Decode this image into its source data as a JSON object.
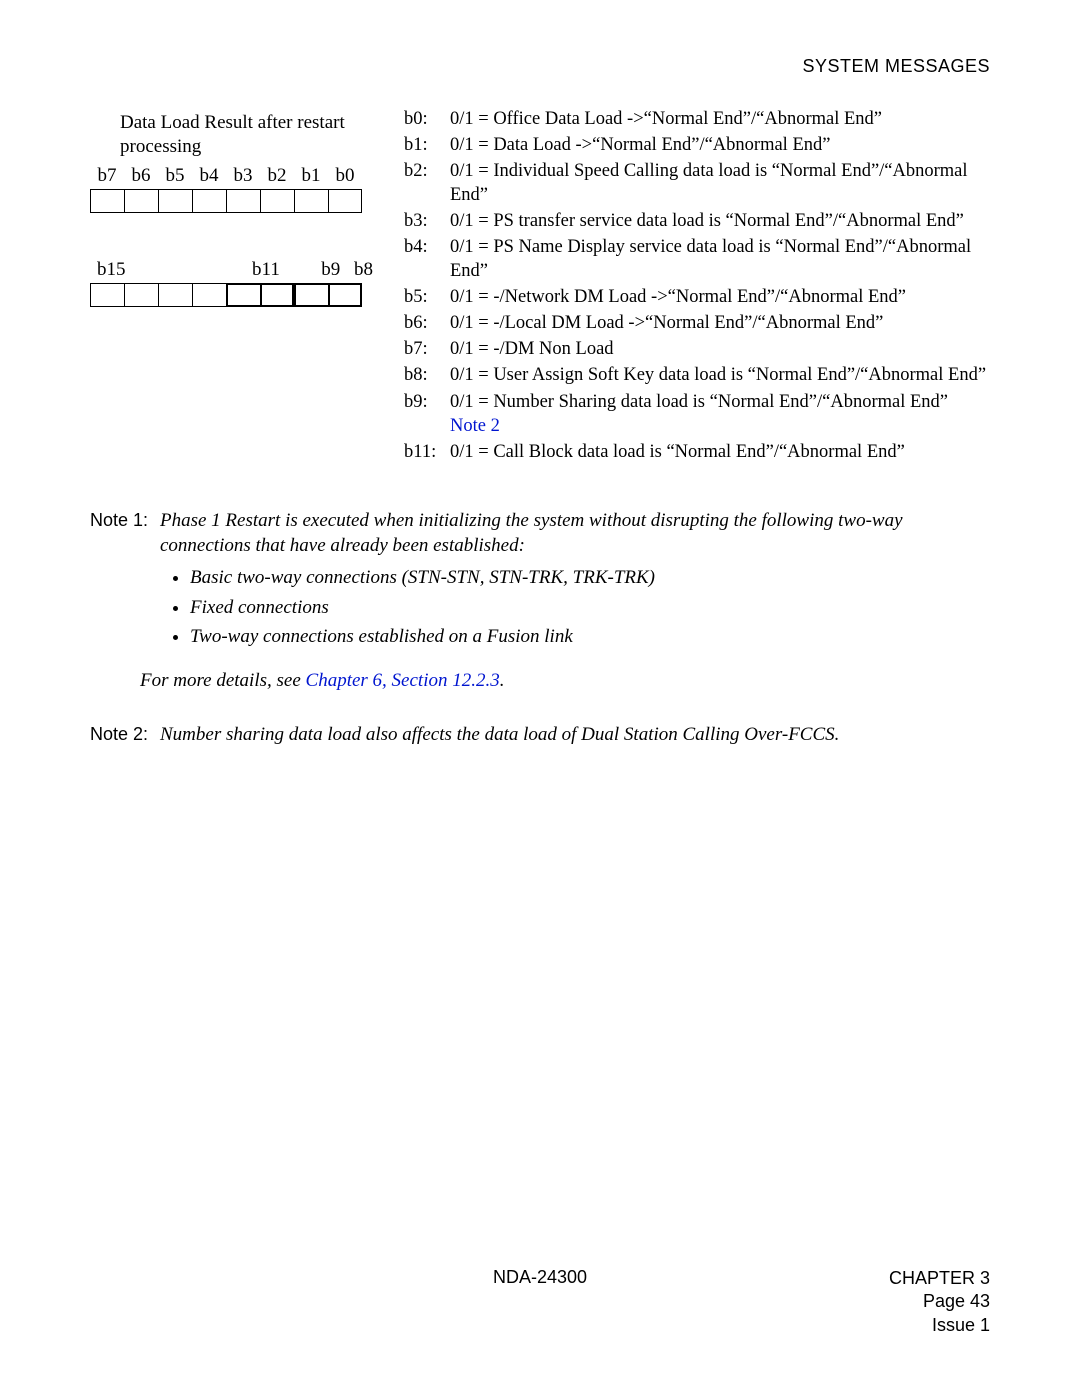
{
  "header": {
    "title": "SYSTEM MESSAGES"
  },
  "diagram": {
    "title": "Data Load Result after restart processing",
    "row1": [
      "b7",
      "b6",
      "b5",
      "b4",
      "b3",
      "b2",
      "b1",
      "b0"
    ],
    "row2": {
      "b15": "b15",
      "b11": "b11",
      "b9": "b9",
      "b8": "b8"
    }
  },
  "bits": {
    "b0": {
      "label": "b0:",
      "text": "0/1 = Office Data Load ->“Normal End”/“Abnormal End”"
    },
    "b1": {
      "label": "b1:",
      "text": "0/1 = Data Load ->“Normal End”/“Abnormal End”"
    },
    "b2": {
      "label": "b2:",
      "text": "0/1 = Individual Speed Calling data load is “Normal End”/“Abnormal End”"
    },
    "b3": {
      "label": "b3:",
      "text": "0/1 = PS transfer service data load is “Normal End”/“Abnormal End”"
    },
    "b4": {
      "label": "b4:",
      "text": "0/1 = PS Name Display service data load is “Normal End”/“Abnormal End”"
    },
    "b5": {
      "label": "b5:",
      "text": "0/1 = -/Network DM Load ->“Normal End”/“Abnormal End”"
    },
    "b6": {
      "label": "b6:",
      "text": "0/1 = -/Local DM Load ->“Normal End”/“Abnormal End”"
    },
    "b7": {
      "label": "b7:",
      "text": "0/1 = -/DM Non Load"
    },
    "b8": {
      "label": "b8:",
      "text": "0/1 = User Assign Soft Key data load is “Normal End”/“Abnormal End”"
    },
    "b9": {
      "label": "b9:",
      "text": "0/1 = Number Sharing data load is “Normal End”/“Abnormal End”"
    },
    "b9_note": "Note 2",
    "b11": {
      "label": "b11:",
      "text": "0/1 = Call Block data load is “Normal End”/“Abnormal End”"
    }
  },
  "notes": {
    "note1": {
      "label": "Note 1:",
      "intro": "Phase 1 Restart is executed when initializing the system without disrupting the following two-way connections that have already been established:",
      "bullets": [
        "Basic two-way connections (STN-STN, STN-TRK, TRK-TRK)",
        "Fixed connections",
        "Two-way connections established on a Fusion link"
      ],
      "tail_prefix": "For more details, see ",
      "tail_link": "Chapter 6, Section 12.2.3",
      "tail_suffix": "."
    },
    "note2": {
      "label": "Note 2:",
      "text": "Number sharing data load also affects the data load of Dual Station Calling Over-FCCS."
    }
  },
  "footer": {
    "doc": "NDA-24300",
    "chapter": "CHAPTER 3",
    "page": "Page 43",
    "issue": "Issue 1"
  }
}
